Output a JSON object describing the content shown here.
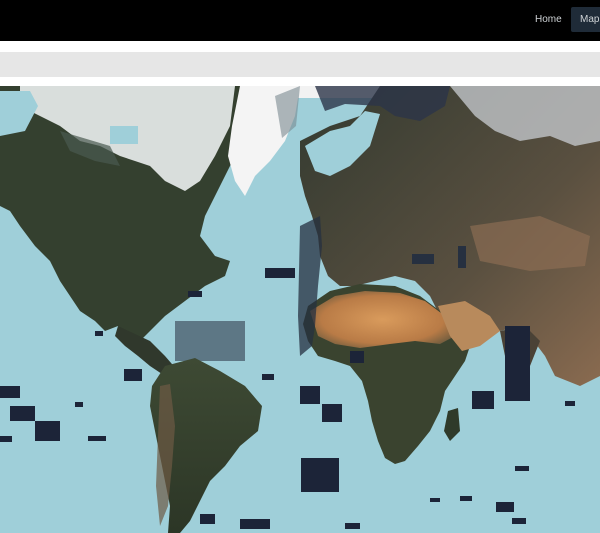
{
  "nav": {
    "items": [
      {
        "label": "Home",
        "active": false
      },
      {
        "label": "Map",
        "active": true
      }
    ]
  },
  "map": {
    "ocean_color": "#9fcfd9",
    "imagery": "satellite"
  },
  "colors": {
    "navbar_bg": "#000000",
    "toolbar_bg": "#e6e6e6",
    "active_tab_bg": "#1f2b38",
    "nav_text": "#cfd3d6"
  }
}
